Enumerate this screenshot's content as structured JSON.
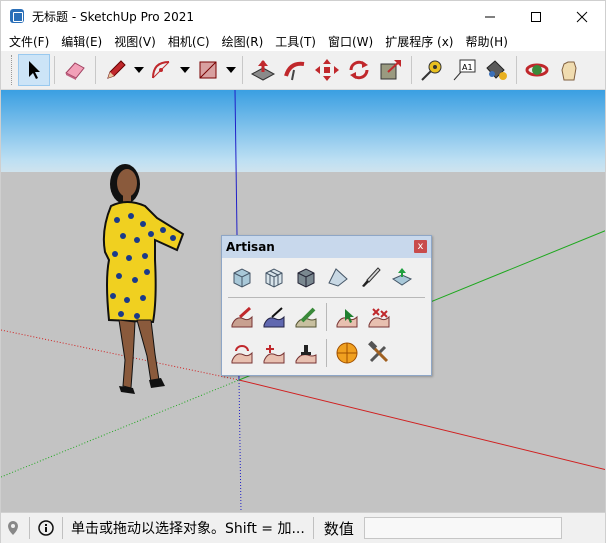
{
  "window": {
    "title": "无标题 - SketchUp Pro 2021"
  },
  "menu": {
    "items": [
      "文件(F)",
      "编辑(E)",
      "视图(V)",
      "相机(C)",
      "绘图(R)",
      "工具(T)",
      "窗口(W)",
      "扩展程序 (x)",
      "帮助(H)"
    ]
  },
  "toolbar": {
    "text_tool_label": "A1"
  },
  "artisan": {
    "title": "Artisan",
    "close_glyph": "x"
  },
  "statusbar": {
    "hint": "单击或拖动以选择对象。Shift = 加...",
    "measure_label": "数值",
    "measure_value": ""
  },
  "colors": {
    "sky_top": "#3a9fe2",
    "ground": "#c3c3c3",
    "axis_red": "#d02020",
    "axis_green": "#1ea81e",
    "axis_blue": "#2020c8",
    "panel_header": "#c8d8ec"
  }
}
